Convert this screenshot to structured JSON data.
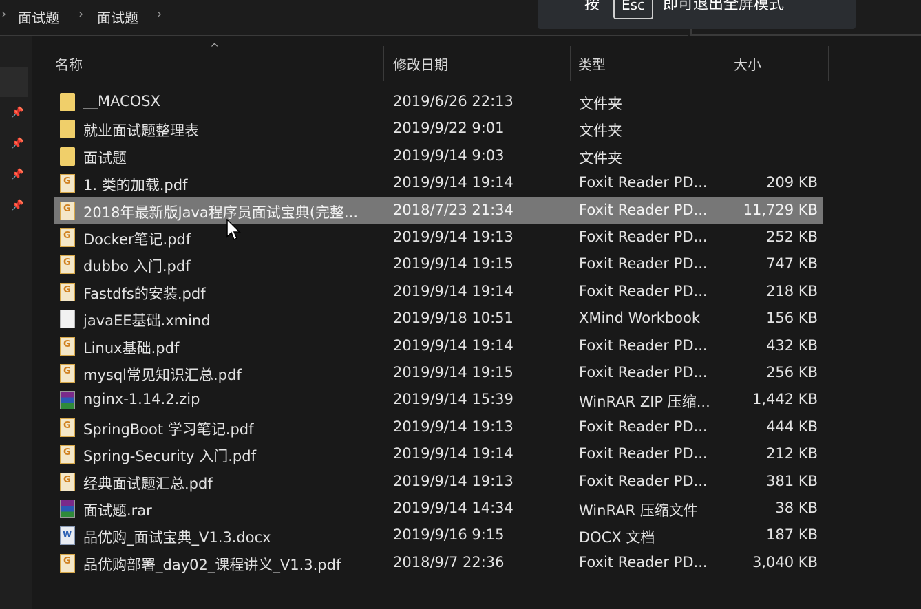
{
  "breadcrumb": [
    "面试题",
    "面试题"
  ],
  "fullscreen_toast": {
    "prefix": "按",
    "key": "Esc",
    "suffix": "即可退出全屏模式"
  },
  "columns": {
    "name": "名称",
    "date": "修改日期",
    "type": "类型",
    "size": "大小"
  },
  "files": [
    {
      "name": "__MACOSX",
      "date": "2019/6/26 22:13",
      "type": "文件夹",
      "size": "",
      "icon": "folder-icon"
    },
    {
      "name": "就业面试题整理表",
      "date": "2019/9/22 9:01",
      "type": "文件夹",
      "size": "",
      "icon": "folder-icon"
    },
    {
      "name": "面试题",
      "date": "2019/9/14 9:03",
      "type": "文件夹",
      "size": "",
      "icon": "folder-icon"
    },
    {
      "name": "1. 类的加载.pdf",
      "date": "2019/9/14 19:14",
      "type": "Foxit Reader PD...",
      "size": "209 KB",
      "icon": "pdf-icon"
    },
    {
      "name": "2018年最新版Java程序员面试宝典(完整...",
      "date": "2018/7/23 21:34",
      "type": "Foxit Reader PD...",
      "size": "11,729 KB",
      "icon": "pdf-icon",
      "selected": true
    },
    {
      "name": "Docker笔记.pdf",
      "date": "2019/9/14 19:13",
      "type": "Foxit Reader PD...",
      "size": "252 KB",
      "icon": "pdf-icon"
    },
    {
      "name": "dubbo 入门.pdf",
      "date": "2019/9/14 19:15",
      "type": "Foxit Reader PD...",
      "size": "747 KB",
      "icon": "pdf-icon"
    },
    {
      "name": "Fastdfs的安装.pdf",
      "date": "2019/9/14 19:14",
      "type": "Foxit Reader PD...",
      "size": "218 KB",
      "icon": "pdf-icon"
    },
    {
      "name": "javaEE基础.xmind",
      "date": "2019/9/18 10:51",
      "type": "XMind Workbook",
      "size": "156 KB",
      "icon": "xmind-icon"
    },
    {
      "name": "Linux基础.pdf",
      "date": "2019/9/14 19:14",
      "type": "Foxit Reader PD...",
      "size": "432 KB",
      "icon": "pdf-icon"
    },
    {
      "name": "mysql常见知识汇总.pdf",
      "date": "2019/9/14 19:15",
      "type": "Foxit Reader PD...",
      "size": "256 KB",
      "icon": "pdf-icon"
    },
    {
      "name": "nginx-1.14.2.zip",
      "date": "2019/9/14 15:39",
      "type": "WinRAR ZIP 压缩...",
      "size": "1,442 KB",
      "icon": "winrar-icon"
    },
    {
      "name": "SpringBoot 学习笔记.pdf",
      "date": "2019/9/14 19:13",
      "type": "Foxit Reader PD...",
      "size": "444 KB",
      "icon": "pdf-icon"
    },
    {
      "name": "Spring-Security 入门.pdf",
      "date": "2019/9/14 19:14",
      "type": "Foxit Reader PD...",
      "size": "212 KB",
      "icon": "pdf-icon"
    },
    {
      "name": "经典面试题汇总.pdf",
      "date": "2019/9/14 19:13",
      "type": "Foxit Reader PD...",
      "size": "381 KB",
      "icon": "pdf-icon"
    },
    {
      "name": "面试题.rar",
      "date": "2019/9/14 14:34",
      "type": "WinRAR 压缩文件",
      "size": "38 KB",
      "icon": "winrar-icon"
    },
    {
      "name": "品优购_面试宝典_V1.3.docx",
      "date": "2019/9/16 9:15",
      "type": "DOCX 文档",
      "size": "187 KB",
      "icon": "docx-icon"
    },
    {
      "name": "品优购部署_day02_课程讲义_V1.3.pdf",
      "date": "2018/9/7 22:36",
      "type": "Foxit Reader PD...",
      "size": "3,040 KB",
      "icon": "pdf-icon"
    }
  ]
}
